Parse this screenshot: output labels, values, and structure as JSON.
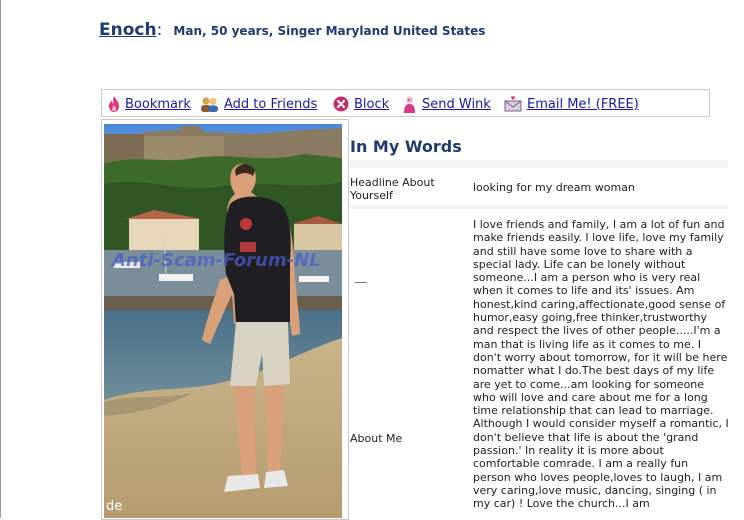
{
  "profile": {
    "name": "Enoch",
    "colon": ":",
    "info": "Man, 50 years,  Singer Maryland United States"
  },
  "actions": [
    {
      "label": "Bookmark",
      "icon": "flame-icon",
      "color": "#e8327a"
    },
    {
      "label": "Add to Friends",
      "icon": "friends-icon",
      "color": "#c08a3c"
    },
    {
      "label": "Block",
      "icon": "block-icon",
      "color": "#c0306a"
    },
    {
      "label": "Send Wink",
      "icon": "wink-icon",
      "color": "#d83a8a"
    },
    {
      "label": "Email Me! (FREE)",
      "icon": "envelope-icon",
      "color": "#7a5a8a"
    }
  ],
  "photo": {
    "watermark": "Anti-Scam-Forum-NL",
    "caption": "de"
  },
  "words": {
    "title": "In My Words",
    "headline_label": "Headline About Yourself",
    "headline_value": "looking for my dream woman",
    "about_label": "About Me",
    "about_value": "I love friends and family, I am a lot of fun and make friends easily. I love life, love my family and still have some love to share with a special lady. Life can be lonely without someone...I am a person who is very real when it comes to life and its' issues. Am honest,kind caring,affectionate,good sense of humor,easy going,free thinker,trustworthy and respect the lives of other people.....I'm a man that is living life as it comes to me. I don't worry about tomorrow, for it will be here nomatter what I do.The best days of my life are yet to come...am looking for someone who will love and care about me for a long time relationship that can lead to marriage. Although I would consider myself a romantic, I don't believe that life is about the 'grand passion.' In reality it is more about comfortable comrade. I am a really fun person who loves people,loves to laugh, I am very caring,love music, dancing, singing ( in my car) ! Love the church...I am"
  },
  "colors": {
    "link": "#1a1aa6",
    "heading": "#1f3b6f",
    "watermark": "#4a5cc8"
  }
}
